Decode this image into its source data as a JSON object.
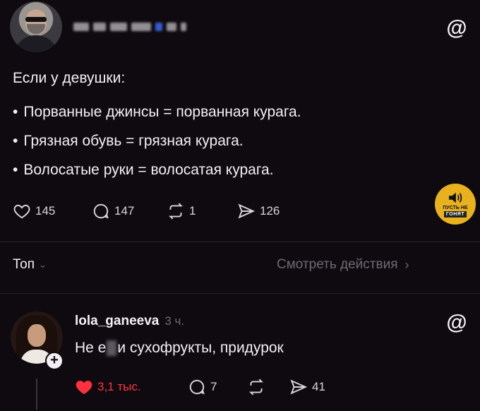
{
  "post": {
    "text_intro": "Если у девушки:",
    "list": [
      "Порванные джинсы = порванная курага.",
      "Грязная обувь = грязная курага.",
      "Волосатые руки = волосатая курага."
    ],
    "likes": "145",
    "replies": "147",
    "reposts": "1",
    "shares": "126"
  },
  "sort": {
    "label": "Топ",
    "see_actions": "Смотреть действия"
  },
  "reply": {
    "username": "lola_ganeeva",
    "time": "3 ч.",
    "text_before": "Не е",
    "text_after": "и сухофрукты, придурок",
    "likes": "3,1 тыс.",
    "replies": "7",
    "shares": "41"
  },
  "watermark": {
    "line1": "ПУСТЬ НЕ",
    "line2": "ГОНЯТ",
    "color": "#e7b21d"
  },
  "icons": {
    "threads": "@",
    "chevron_down": "⌄",
    "chevron_right": "›",
    "plus": "+"
  },
  "colors": {
    "background": "#0f0a10",
    "liked": "#ff3040"
  }
}
